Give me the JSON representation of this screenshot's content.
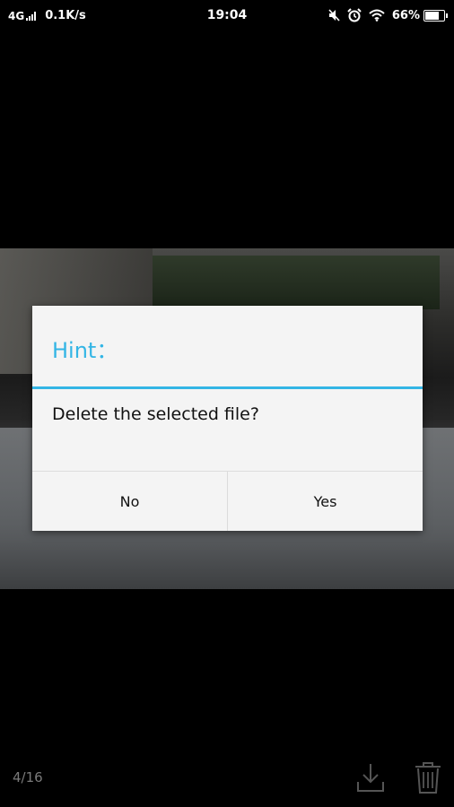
{
  "status_bar": {
    "network_type": "4G",
    "speed": "0.1K/s",
    "time": "19:04",
    "battery_percent": "66%",
    "battery_level": 0.66,
    "icons": [
      "signal-icon",
      "mute-icon",
      "alarm-icon",
      "wifi-icon",
      "battery-icon"
    ]
  },
  "dialog": {
    "title": "Hint：",
    "message": "Delete the selected file?",
    "no_label": "No",
    "yes_label": "Yes",
    "accent_color": "#33b5e5"
  },
  "viewer": {
    "counter": "4/16",
    "icons": [
      "download-icon",
      "trash-icon"
    ]
  }
}
